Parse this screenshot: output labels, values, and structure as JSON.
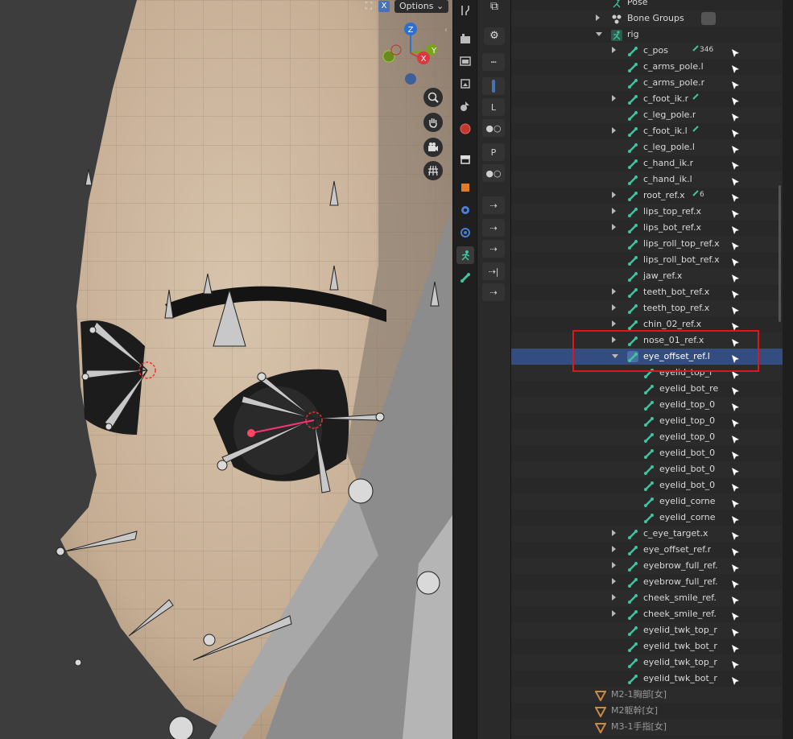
{
  "viewport": {
    "options_label": "Options",
    "x_toggle": "X",
    "gizmo": {
      "z": "Z",
      "y": "Y",
      "x": "X"
    },
    "nav_buttons": [
      "zoom-icon",
      "hand-pan-icon",
      "camera-icon",
      "grid-icon"
    ]
  },
  "tabs": [
    "tool-icon",
    "render-icon",
    "output-icon",
    "view-layer-icon",
    "scene-icon",
    "world-icon",
    "collection-icon",
    "object-icon",
    "modifier-icon",
    "physics-icon",
    "armature-data-icon",
    "bone-icon"
  ],
  "props": {
    "l_label": "L",
    "p_label": "P"
  },
  "outliner": {
    "rows": [
      {
        "label": "Pose",
        "indent": 1,
        "disc": "none",
        "icon": "pose-icon",
        "cursor": false
      },
      {
        "label": "Bone Groups",
        "indent": 1,
        "disc": "collapsed",
        "icon": "bone-groups-icon",
        "cursor": false,
        "extra": "group-icon"
      },
      {
        "label": "rig",
        "indent": 1,
        "disc": "expanded",
        "icon": "armature-icon",
        "cursor": false
      },
      {
        "label": "c_pos",
        "indent": 2,
        "disc": "collapsed",
        "icon": "bone-icon",
        "cursor": true,
        "badge": "346"
      },
      {
        "label": "c_arms_pole.l",
        "indent": 2,
        "disc": "none",
        "icon": "bone-icon",
        "cursor": true
      },
      {
        "label": "c_arms_pole.r",
        "indent": 2,
        "disc": "none",
        "icon": "bone-icon",
        "cursor": true
      },
      {
        "label": "c_foot_ik.r",
        "indent": 2,
        "disc": "collapsed",
        "icon": "bone-icon",
        "cursor": true,
        "badge": " "
      },
      {
        "label": "c_leg_pole.r",
        "indent": 2,
        "disc": "none",
        "icon": "bone-icon",
        "cursor": true
      },
      {
        "label": "c_foot_ik.l",
        "indent": 2,
        "disc": "collapsed",
        "icon": "bone-icon",
        "cursor": true,
        "badge": " "
      },
      {
        "label": "c_leg_pole.l",
        "indent": 2,
        "disc": "none",
        "icon": "bone-icon",
        "cursor": true
      },
      {
        "label": "c_hand_ik.r",
        "indent": 2,
        "disc": "none",
        "icon": "bone-icon",
        "cursor": true
      },
      {
        "label": "c_hand_ik.l",
        "indent": 2,
        "disc": "none",
        "icon": "bone-icon",
        "cursor": true
      },
      {
        "label": "root_ref.x",
        "indent": 2,
        "disc": "collapsed",
        "icon": "bone-icon",
        "cursor": true,
        "badge": "6"
      },
      {
        "label": "lips_top_ref.x",
        "indent": 2,
        "disc": "collapsed",
        "icon": "bone-icon",
        "cursor": true
      },
      {
        "label": "lips_bot_ref.x",
        "indent": 2,
        "disc": "collapsed",
        "icon": "bone-icon",
        "cursor": true
      },
      {
        "label": "lips_roll_top_ref.x",
        "indent": 2,
        "disc": "none",
        "icon": "bone-icon",
        "cursor": true
      },
      {
        "label": "lips_roll_bot_ref.x",
        "indent": 2,
        "disc": "none",
        "icon": "bone-icon",
        "cursor": true
      },
      {
        "label": "jaw_ref.x",
        "indent": 2,
        "disc": "none",
        "icon": "bone-icon",
        "cursor": true
      },
      {
        "label": "teeth_bot_ref.x",
        "indent": 2,
        "disc": "collapsed",
        "icon": "bone-icon",
        "cursor": true
      },
      {
        "label": "teeth_top_ref.x",
        "indent": 2,
        "disc": "collapsed",
        "icon": "bone-icon",
        "cursor": true
      },
      {
        "label": "chin_02_ref.x",
        "indent": 2,
        "disc": "collapsed",
        "icon": "bone-icon",
        "cursor": true
      },
      {
        "label": "nose_01_ref.x",
        "indent": 2,
        "disc": "collapsed",
        "icon": "bone-icon",
        "cursor": true
      },
      {
        "label": "eye_offset_ref.l",
        "indent": 2,
        "disc": "expanded",
        "icon": "bone-icon",
        "cursor": true,
        "selected": true
      },
      {
        "label": "eyelid_top_r",
        "indent": 3,
        "disc": "none",
        "icon": "bone-icon",
        "cursor": true
      },
      {
        "label": "eyelid_bot_re",
        "indent": 3,
        "disc": "none",
        "icon": "bone-icon",
        "cursor": true
      },
      {
        "label": "eyelid_top_0",
        "indent": 3,
        "disc": "none",
        "icon": "bone-icon",
        "cursor": true
      },
      {
        "label": "eyelid_top_0",
        "indent": 3,
        "disc": "none",
        "icon": "bone-icon",
        "cursor": true
      },
      {
        "label": "eyelid_top_0",
        "indent": 3,
        "disc": "none",
        "icon": "bone-icon",
        "cursor": true
      },
      {
        "label": "eyelid_bot_0",
        "indent": 3,
        "disc": "none",
        "icon": "bone-icon",
        "cursor": true
      },
      {
        "label": "eyelid_bot_0",
        "indent": 3,
        "disc": "none",
        "icon": "bone-icon",
        "cursor": true
      },
      {
        "label": "eyelid_bot_0",
        "indent": 3,
        "disc": "none",
        "icon": "bone-icon",
        "cursor": true
      },
      {
        "label": "eyelid_corne",
        "indent": 3,
        "disc": "none",
        "icon": "bone-icon",
        "cursor": true
      },
      {
        "label": "eyelid_corne",
        "indent": 3,
        "disc": "none",
        "icon": "bone-icon",
        "cursor": true
      },
      {
        "label": "c_eye_target.x",
        "indent": 2,
        "disc": "collapsed",
        "icon": "bone-icon",
        "cursor": true
      },
      {
        "label": "eye_offset_ref.r",
        "indent": 2,
        "disc": "collapsed",
        "icon": "bone-icon",
        "cursor": true
      },
      {
        "label": "eyebrow_full_ref.",
        "indent": 2,
        "disc": "collapsed",
        "icon": "bone-icon",
        "cursor": true
      },
      {
        "label": "eyebrow_full_ref.",
        "indent": 2,
        "disc": "collapsed",
        "icon": "bone-icon",
        "cursor": true
      },
      {
        "label": "cheek_smile_ref.",
        "indent": 2,
        "disc": "collapsed",
        "icon": "bone-icon",
        "cursor": true
      },
      {
        "label": "cheek_smile_ref.",
        "indent": 2,
        "disc": "collapsed",
        "icon": "bone-icon",
        "cursor": true
      },
      {
        "label": "eyelid_twk_top_r",
        "indent": 2,
        "disc": "none",
        "icon": "bone-icon",
        "cursor": true
      },
      {
        "label": "eyelid_twk_bot_r",
        "indent": 2,
        "disc": "none",
        "icon": "bone-icon",
        "cursor": true
      },
      {
        "label": "eyelid_twk_top_r",
        "indent": 2,
        "disc": "none",
        "icon": "bone-icon",
        "cursor": true
      },
      {
        "label": "eyelid_twk_bot_r",
        "indent": 2,
        "disc": "none",
        "icon": "bone-icon",
        "cursor": true
      },
      {
        "label": "M2-1胸部[女]",
        "indent": 0,
        "disc": "none",
        "icon": "shape-key-icon",
        "cursor": false,
        "dim": true
      },
      {
        "label": "M2躯幹[女]",
        "indent": 0,
        "disc": "none",
        "icon": "shape-key-icon",
        "cursor": false,
        "dim": true
      },
      {
        "label": "M3-1手指[女]",
        "indent": 0,
        "disc": "none",
        "icon": "shape-key-icon",
        "cursor": false,
        "dim": true
      }
    ]
  },
  "colors": {
    "highlight_box": "#e0161c",
    "selected_row": "#334d80",
    "bone_icon": "#3ec5a0"
  }
}
